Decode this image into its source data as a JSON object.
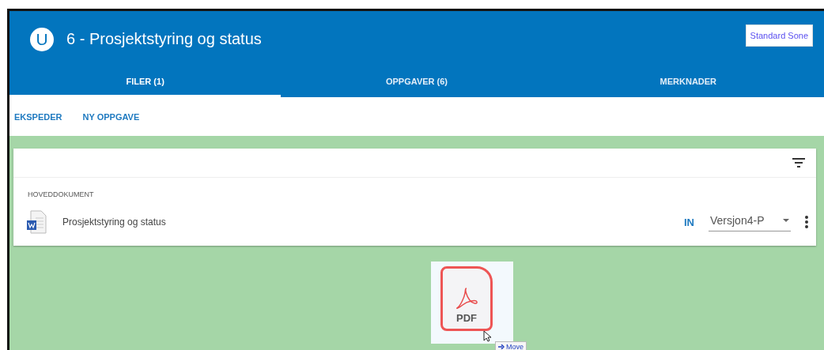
{
  "header": {
    "avatar": "U",
    "title": "6 - Prosjektstyring og status",
    "zone_button": "Standard Sone"
  },
  "tabs": [
    {
      "label": "FILER (1)",
      "selected": true
    },
    {
      "label": "OPPGAVER (6)",
      "selected": false
    },
    {
      "label": "MERKNADER",
      "selected": false
    }
  ],
  "actions": [
    "EKSPEDER",
    "NY OPPGAVE"
  ],
  "card": {
    "section_label": "HOVEDDOKUMENT",
    "document": {
      "name": "Prosjektstyring og status",
      "status": "IN",
      "version": "Versjon4-P"
    }
  },
  "drag_ghost": {
    "file_label": "PDF",
    "tooltip": "Move"
  }
}
